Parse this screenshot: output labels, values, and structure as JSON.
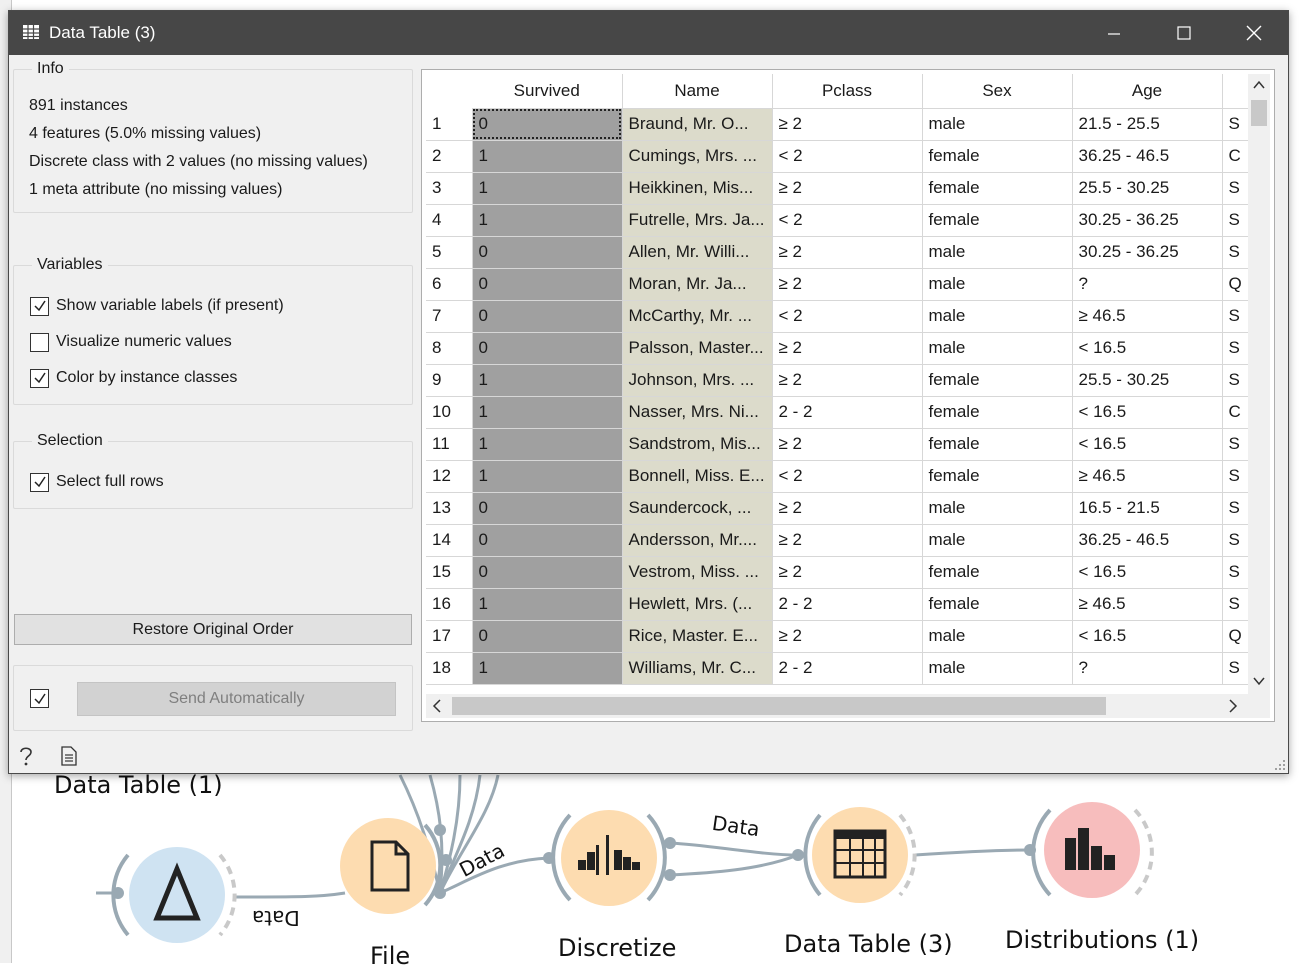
{
  "window": {
    "title": "Data Table (3)"
  },
  "info": {
    "title": "Info",
    "lines": [
      "891 instances",
      "4 features (5.0% missing values)",
      "Discrete class with 2 values (no missing values)",
      "1 meta attribute (no missing values)"
    ]
  },
  "variables": {
    "title": "Variables",
    "options": [
      {
        "label": "Show variable labels (if present)",
        "checked": true
      },
      {
        "label": "Visualize numeric values",
        "checked": false
      },
      {
        "label": "Color by instance classes",
        "checked": true
      }
    ]
  },
  "selection": {
    "title": "Selection",
    "options": [
      {
        "label": "Select full rows",
        "checked": true
      }
    ]
  },
  "buttons": {
    "restore": "Restore Original Order",
    "send": "Send Automatically",
    "send_auto_checked": true
  },
  "table": {
    "columns": [
      "Survived",
      "Name",
      "Pclass",
      "Sex",
      "Age",
      ""
    ],
    "rows": [
      [
        "1",
        "0",
        "Braund, Mr. O...",
        "≥ 2",
        "male",
        "21.5 - 25.5",
        "S"
      ],
      [
        "2",
        "1",
        "Cumings, Mrs. ...",
        "< 2",
        "female",
        "36.25 - 46.5",
        "C"
      ],
      [
        "3",
        "1",
        "Heikkinen, Mis...",
        "≥ 2",
        "female",
        "25.5 - 30.25",
        "S"
      ],
      [
        "4",
        "1",
        "Futrelle, Mrs. Ja...",
        "< 2",
        "female",
        "30.25 - 36.25",
        "S"
      ],
      [
        "5",
        "0",
        "Allen, Mr. Willi...",
        "≥ 2",
        "male",
        "30.25 - 36.25",
        "S"
      ],
      [
        "6",
        "0",
        "Moran, Mr. Ja...",
        "≥ 2",
        "male",
        "?",
        "Q"
      ],
      [
        "7",
        "0",
        "McCarthy, Mr. ...",
        "< 2",
        "male",
        "≥ 46.5",
        "S"
      ],
      [
        "8",
        "0",
        "Palsson, Master...",
        "≥ 2",
        "male",
        "< 16.5",
        "S"
      ],
      [
        "9",
        "1",
        "Johnson, Mrs. ...",
        "≥ 2",
        "female",
        "25.5 - 30.25",
        "S"
      ],
      [
        "10",
        "1",
        "Nasser, Mrs. Ni...",
        "2 - 2",
        "female",
        "< 16.5",
        "C"
      ],
      [
        "11",
        "1",
        "Sandstrom, Mis...",
        "≥ 2",
        "female",
        "< 16.5",
        "S"
      ],
      [
        "12",
        "1",
        "Bonnell, Miss. E...",
        "< 2",
        "female",
        "≥ 46.5",
        "S"
      ],
      [
        "13",
        "0",
        "Saundercock, ...",
        "≥ 2",
        "male",
        "16.5 - 21.5",
        "S"
      ],
      [
        "14",
        "0",
        "Andersson, Mr....",
        "≥ 2",
        "male",
        "36.25 - 46.5",
        "S"
      ],
      [
        "15",
        "0",
        "Vestrom, Miss. ...",
        "≥ 2",
        "female",
        "< 16.5",
        "S"
      ],
      [
        "16",
        "1",
        "Hewlett, Mrs. (...",
        "2 - 2",
        "female",
        "≥ 46.5",
        "S"
      ],
      [
        "17",
        "0",
        "Rice, Master. E...",
        "≥ 2",
        "male",
        "< 16.5",
        "Q"
      ],
      [
        "18",
        "1",
        "Williams, Mr. C...",
        "2 - 2",
        "male",
        "?",
        "S"
      ]
    ]
  },
  "canvas": {
    "nodes": [
      {
        "label": "Data Table (1)"
      },
      {
        "label": "File"
      },
      {
        "label": "Discretize"
      },
      {
        "label": "Data Table (3)"
      },
      {
        "label": "Distributions (1)"
      }
    ],
    "link_labels": [
      "Data",
      "Data",
      "Data"
    ]
  },
  "colors": {
    "titlebar": "#474747",
    "survived_cell": "#a0a0a0",
    "name_cell": "#dcdbcb",
    "node_orange": "#fddcb0",
    "node_blue": "#cfe3f2",
    "node_red": "#f7bdbd"
  }
}
